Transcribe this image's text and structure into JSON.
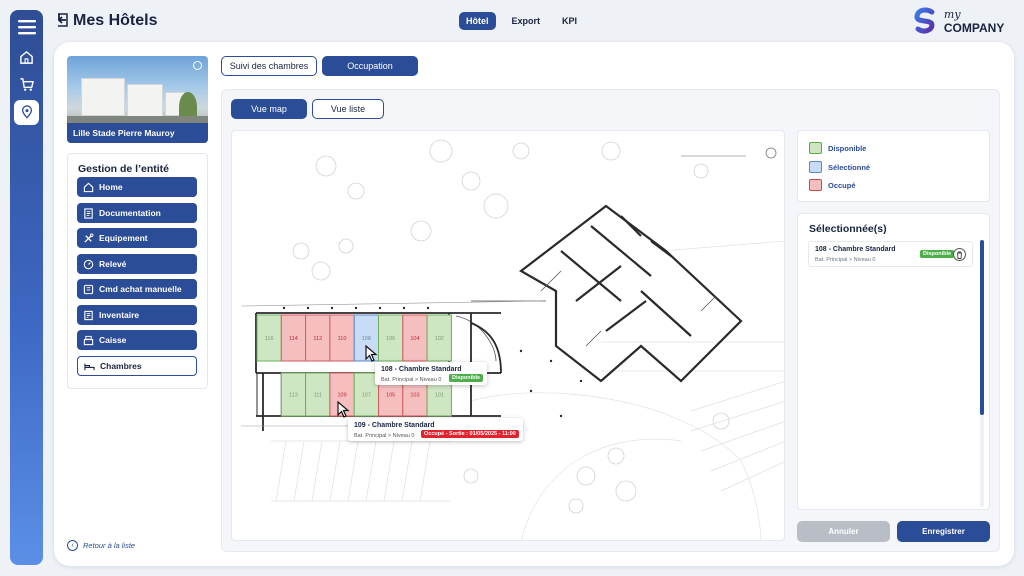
{
  "header": {
    "title": "Mes Hôtels",
    "tabs": [
      {
        "label": "Hôtel",
        "active": true
      },
      {
        "label": "Export",
        "active": false
      },
      {
        "label": "KPI",
        "active": false
      }
    ],
    "logo": {
      "prefix": "my",
      "name": "COMPANY"
    }
  },
  "rail": {
    "icons": [
      "menu-icon",
      "home-icon",
      "cart-icon",
      "location-pin-icon"
    ],
    "active": "location-pin-icon"
  },
  "hotel": {
    "name": "Lille Stade Pierre Mauroy"
  },
  "entity_menu": {
    "title": "Gestion de l’entité",
    "items": [
      {
        "label": "Home",
        "icon": "home-icon"
      },
      {
        "label": "Documentation",
        "icon": "document-icon"
      },
      {
        "label": "Equipement",
        "icon": "tools-icon"
      },
      {
        "label": "Relevé",
        "icon": "gauge-icon"
      },
      {
        "label": "Cmd achat manuelle",
        "icon": "cart-icon"
      },
      {
        "label": "Inventaire",
        "icon": "inventory-icon"
      },
      {
        "label": "Caisse",
        "icon": "cash-register-icon"
      },
      {
        "label": "Chambres",
        "icon": "bed-icon",
        "selected": true
      }
    ]
  },
  "back_to_list": "Retour à la liste",
  "top_tabs": [
    {
      "label": "Suivi des chambres",
      "active": false
    },
    {
      "label": "Occupation",
      "active": true
    }
  ],
  "view_tabs": [
    {
      "label": "Vue map",
      "active": true
    },
    {
      "label": "Vue liste",
      "active": false
    }
  ],
  "legend": [
    {
      "label": "Disponible",
      "color": "#cfe6c2",
      "border": "#5aa64e"
    },
    {
      "label": "Sélectionné",
      "color": "#c9dcf5",
      "border": "#5b87c9"
    },
    {
      "label": "Occupé",
      "color": "#f5bfc0",
      "border": "#d0484f"
    }
  ],
  "rooms_top": [
    {
      "num": "116",
      "status": "disponible"
    },
    {
      "num": "114",
      "status": "occupe"
    },
    {
      "num": "112",
      "status": "occupe"
    },
    {
      "num": "110",
      "status": "occupe"
    },
    {
      "num": "108",
      "status": "selectionne"
    },
    {
      "num": "106",
      "status": "disponible"
    },
    {
      "num": "104",
      "status": "occupe"
    },
    {
      "num": "102",
      "status": "disponible"
    }
  ],
  "rooms_bottom": [
    {
      "num": "",
      "status": "none"
    },
    {
      "num": "113",
      "status": "disponible"
    },
    {
      "num": "111",
      "status": "disponible"
    },
    {
      "num": "109",
      "status": "occupe"
    },
    {
      "num": "107",
      "status": "disponible"
    },
    {
      "num": "105",
      "status": "occupe"
    },
    {
      "num": "103",
      "status": "occupe"
    },
    {
      "num": "101",
      "status": "disponible"
    }
  ],
  "tooltips": [
    {
      "name": "108 - Chambre Standard",
      "location": "Bat. Principal > Niveau 0",
      "badge": "Disponible",
      "badge_type": "green"
    },
    {
      "name": "109 - Chambre Standard",
      "location": "Bat. Principal > Niveau 0",
      "badge": "Occupé - Sortie : 01/05/2025 - 11:00",
      "badge_type": "red"
    }
  ],
  "selected_panel": {
    "title": "Sélectionnée(s)",
    "items": [
      {
        "name": "108 - Chambre Standard",
        "location": "Bat. Principal > Niveau 0",
        "badge": "Disponible"
      }
    ]
  },
  "actions": {
    "cancel": "Annuler",
    "save": "Enregistrer"
  }
}
